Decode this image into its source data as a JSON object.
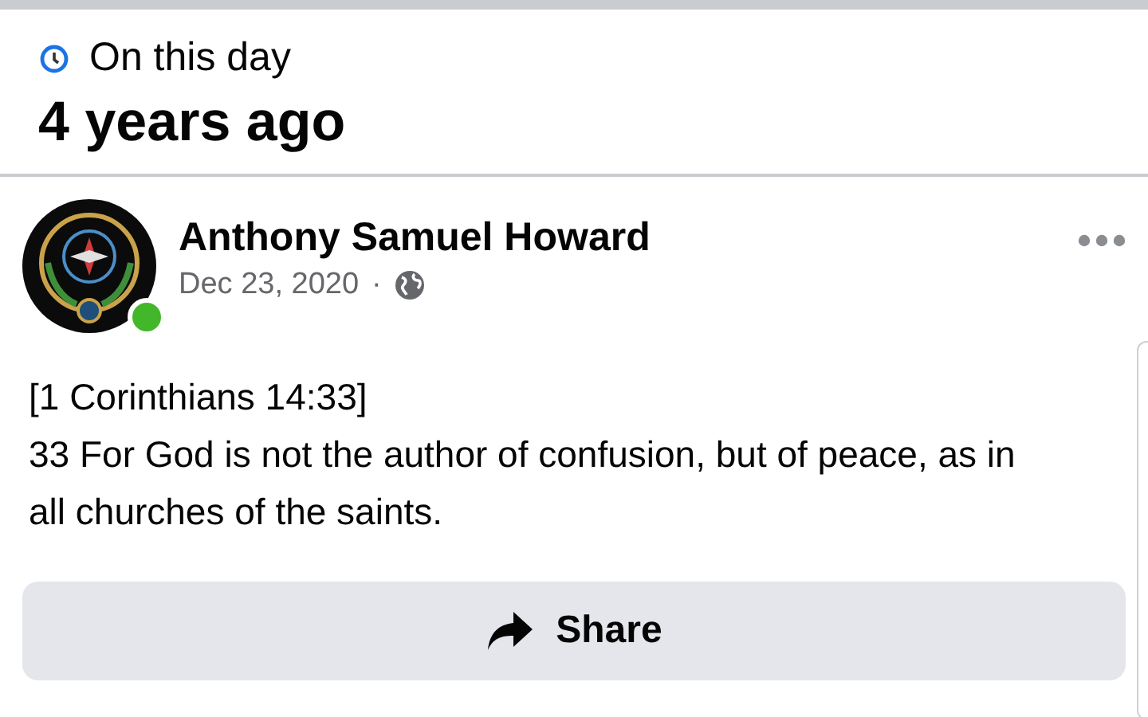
{
  "memory_header": {
    "label": "On this day",
    "title": "4 years ago"
  },
  "post": {
    "author": "Anthony Samuel Howard",
    "online": true,
    "date": "Dec 23, 2020",
    "separator": "·",
    "body_lines": [
      "[1 Corinthians 14:33]",
      "33 For God is not the author of confusion, but of peace, as in all churches of the saints."
    ],
    "share_button": "Share"
  }
}
